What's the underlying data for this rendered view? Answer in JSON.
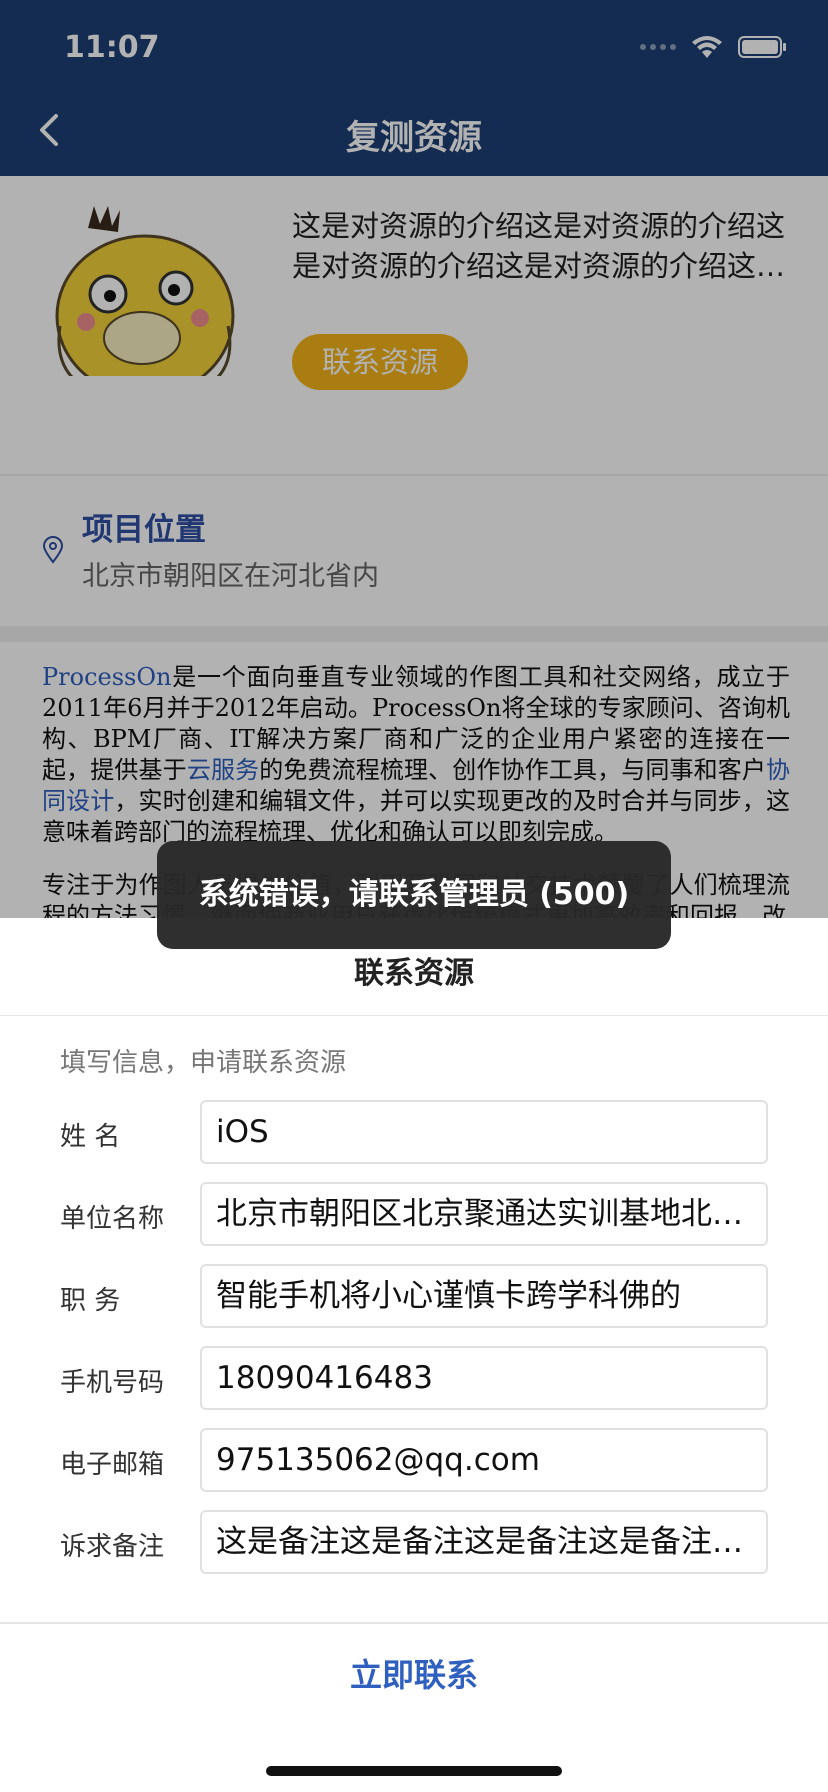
{
  "status_bar": {
    "time": "11:07"
  },
  "nav": {
    "title": "复测资源",
    "back_icon": "chevron-left-icon"
  },
  "resource": {
    "description": "这是对资源的介绍这是对资源的介绍这是对资源的介绍这是对资源的介绍这是对资源的介绍",
    "contact_button": "联系资源"
  },
  "location": {
    "title": "项目位置",
    "address": "北京市朝阳区在河北省内"
  },
  "article": {
    "p1": [
      {
        "text": "ProcessOn",
        "link": true
      },
      {
        "text": "是一个面向垂直专业领域的作图工具和社交网络，成立于2011年6月并于2012年启动。ProcessOn将全球的专家顾问、咨询机构、BPM厂商、IT解决方案厂商和广泛的企业用户紧密的连接在一起，提供基于",
        "link": false
      },
      {
        "text": "云服务",
        "link": true
      },
      {
        "text": "的免费流程梳理、创作协作工具，与同事和客户",
        "link": false
      },
      {
        "text": "协同设计",
        "link": true
      },
      {
        "text": "，实时创建和编辑文件，并可以实现更改的及时合并与同步，这意味着跨部门的流程梳理、优化和确认可以即刻完成。",
        "link": false
      }
    ],
    "p2": "专注于为作图人员提供价值，利用互联网和社交技术颠覆了人们梳理流程的方法习惯，继而使商业用户获得比传统模式更加高效率和回报。改"
  },
  "sheet": {
    "title": "联系资源",
    "hint": "填写信息，申请联系资源",
    "fields": [
      {
        "label": "姓 名",
        "value": "iOS"
      },
      {
        "label": "单位名称",
        "value": "北京市朝阳区北京聚通达实训基地北京聚通达实训基地"
      },
      {
        "label": "职 务",
        "value": "智能手机将小心谨慎卡跨学科佛的"
      },
      {
        "label": "手机号码",
        "value": "18090416483"
      },
      {
        "label": "电子邮箱",
        "value": "975135062@qq.com"
      },
      {
        "label": "诉求备注",
        "value": "这是备注这是备注这是备注这是备注这是备注"
      }
    ],
    "submit": "立即联系"
  },
  "toast": {
    "message": "系统错误，请联系管理员 (500)"
  },
  "colors": {
    "nav_bg": "#1d3f74",
    "accent_yellow": "#f3b41b",
    "link_blue": "#2f5fbf",
    "location_title": "#2f4fa3"
  }
}
